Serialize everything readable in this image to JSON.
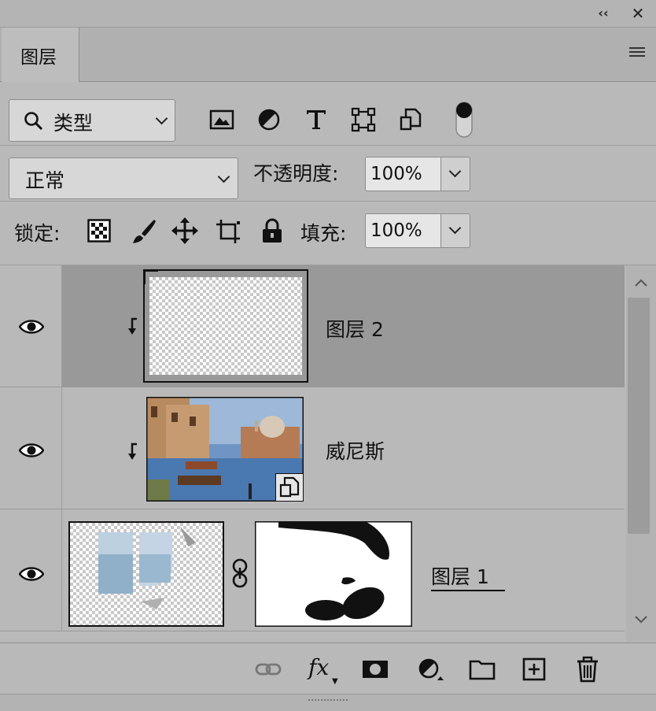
{
  "panel": {
    "tab_label": "图层"
  },
  "filter": {
    "kind_label": "类型",
    "icons": [
      "image-filter-icon",
      "adjustment-filter-icon",
      "type-filter-icon",
      "shape-filter-icon",
      "smart-object-filter-icon",
      "filter-toggle-icon"
    ]
  },
  "blend": {
    "mode": "正常",
    "opacity_label": "不透明度:",
    "opacity_value": "100%"
  },
  "lock": {
    "label": "锁定:",
    "icons": [
      "lock-transparent-icon",
      "lock-image-icon",
      "lock-position-icon",
      "lock-artboard-icon",
      "lock-all-icon"
    ],
    "fill_label": "填充:",
    "fill_value": "100%"
  },
  "layers": [
    {
      "name": "图层 2",
      "visible": true,
      "clipped": true,
      "selected": true,
      "thumbnail": "transparent"
    },
    {
      "name": "威尼斯",
      "visible": true,
      "clipped": true,
      "selected": false,
      "thumbnail": "venice-photo-smart-object"
    },
    {
      "name": "图层 1",
      "visible": true,
      "clipped": false,
      "selected": false,
      "thumbnail": "transparent-with-mask",
      "has_mask": true
    }
  ],
  "footer": {
    "icons": [
      "link-layers-icon",
      "fx-icon",
      "add-mask-icon",
      "adjustment-layer-icon",
      "new-group-icon",
      "new-layer-icon",
      "delete-layer-icon"
    ],
    "fx_label": "fx"
  },
  "colors": {
    "panel_bg": "#b9b9b9",
    "selected_row": "#999999"
  }
}
